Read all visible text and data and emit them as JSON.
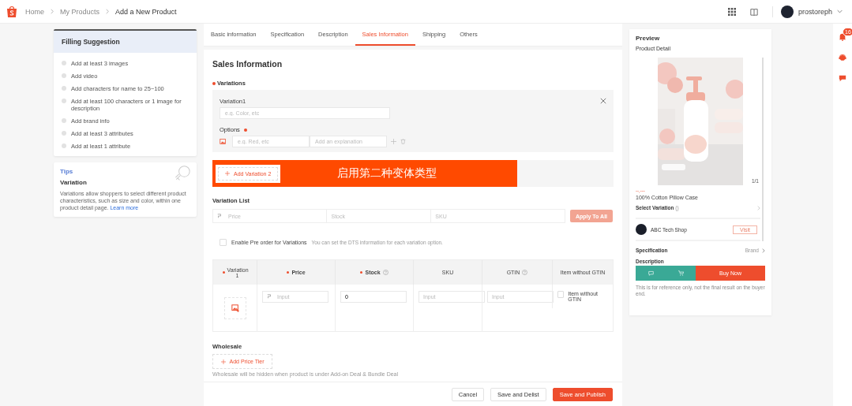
{
  "header": {
    "breadcrumb": [
      "Home",
      "My Products",
      "Add a New Product"
    ],
    "username": "prostoreph"
  },
  "suggestions": {
    "title": "Filling Suggestion",
    "items": [
      {
        "text": "Add at least 3 images",
        "done": false
      },
      {
        "text": "Add video",
        "done": false
      },
      {
        "text": "Add characters for name to 25~100",
        "done": false
      },
      {
        "text": "Add at least 100 characters or 1 image for description",
        "done": false
      },
      {
        "text": "Add brand info",
        "done": false
      },
      {
        "text": "Add at least 3 attributes",
        "done": false
      },
      {
        "text": "Add at least 1 attribute",
        "done": false
      }
    ]
  },
  "tips": {
    "title": "Tips",
    "heading": "Variation",
    "body": "Variations allow shoppers to select different product characteristics, such as size and color, within one product detail page.",
    "link": "Learn more"
  },
  "tabs": [
    {
      "label": "Basic information",
      "selected": false
    },
    {
      "label": "Specification",
      "selected": false
    },
    {
      "label": "Description",
      "selected": false
    },
    {
      "label": "Sales Information",
      "selected": true
    },
    {
      "label": "Shipping",
      "selected": false
    },
    {
      "label": "Others",
      "selected": false
    }
  ],
  "sales": {
    "title": "Sales Information",
    "variations_label": "Variations",
    "variation": {
      "name_label": "Variation1",
      "name_placeholder": "e.g. Color, etc",
      "options_label": "Options",
      "option_placeholder": "e.g. Red, etc",
      "explanation_placeholder": "Add an explanation"
    },
    "add_variation_button": "Add Variation 2",
    "annotation": "启用第二种变体类型",
    "variation_list": {
      "title": "Variation List",
      "price_placeholder": "Price",
      "stock_placeholder": "Stock",
      "sku_placeholder": "SKU",
      "apply_button": "Apply To All"
    },
    "preorder": {
      "label": "Enable Pre order for Variations",
      "hint": "You can set the DTS information for each variation option.",
      "checked": false
    },
    "table": {
      "columns": [
        {
          "label": "Variation 1",
          "required": true,
          "help": false
        },
        {
          "label": "Price",
          "required": true,
          "help": false
        },
        {
          "label": "Stock",
          "required": true,
          "help": true
        },
        {
          "label": "SKU",
          "required": false,
          "help": false
        },
        {
          "label": "GTIN",
          "required": false,
          "help": true
        },
        {
          "label": "Item without GTIN",
          "required": false,
          "help": false
        }
      ],
      "row": {
        "price_placeholder": "Input",
        "stock_value": "0",
        "sku_placeholder": "Input",
        "gtin_placeholder": "Input",
        "without_gtin": {
          "label": "Item without GTIN",
          "checked": false
        }
      }
    },
    "wholesale": {
      "title": "Wholesale",
      "button": "Add Price Tier",
      "note": "Wholesale will be hidden when product is under Add-on Deal & Bundle Deal"
    }
  },
  "footer": {
    "buttons": [
      {
        "label": "Cancel",
        "kind": "plain"
      },
      {
        "label": "Save and Delist",
        "kind": "plain"
      },
      {
        "label": "Save and Publish",
        "kind": "primary"
      }
    ]
  },
  "preview": {
    "title": "Preview",
    "subtitle": "Product Detail",
    "image_counter": "1/1",
    "price": "--,---",
    "product_name": "100% Cotton Pillow Case",
    "select_variation": "Select Variation",
    "select_variation_count": "()",
    "shop_name": "ABC Tech Shop",
    "visit_button": "Visit",
    "specification": "Specification",
    "spec_value": "Brand",
    "description": "Description",
    "buy_now": "Buy Now",
    "note": "This is for reference only, not the final result on the buyer end."
  },
  "rail": {
    "notification_count": "16"
  }
}
